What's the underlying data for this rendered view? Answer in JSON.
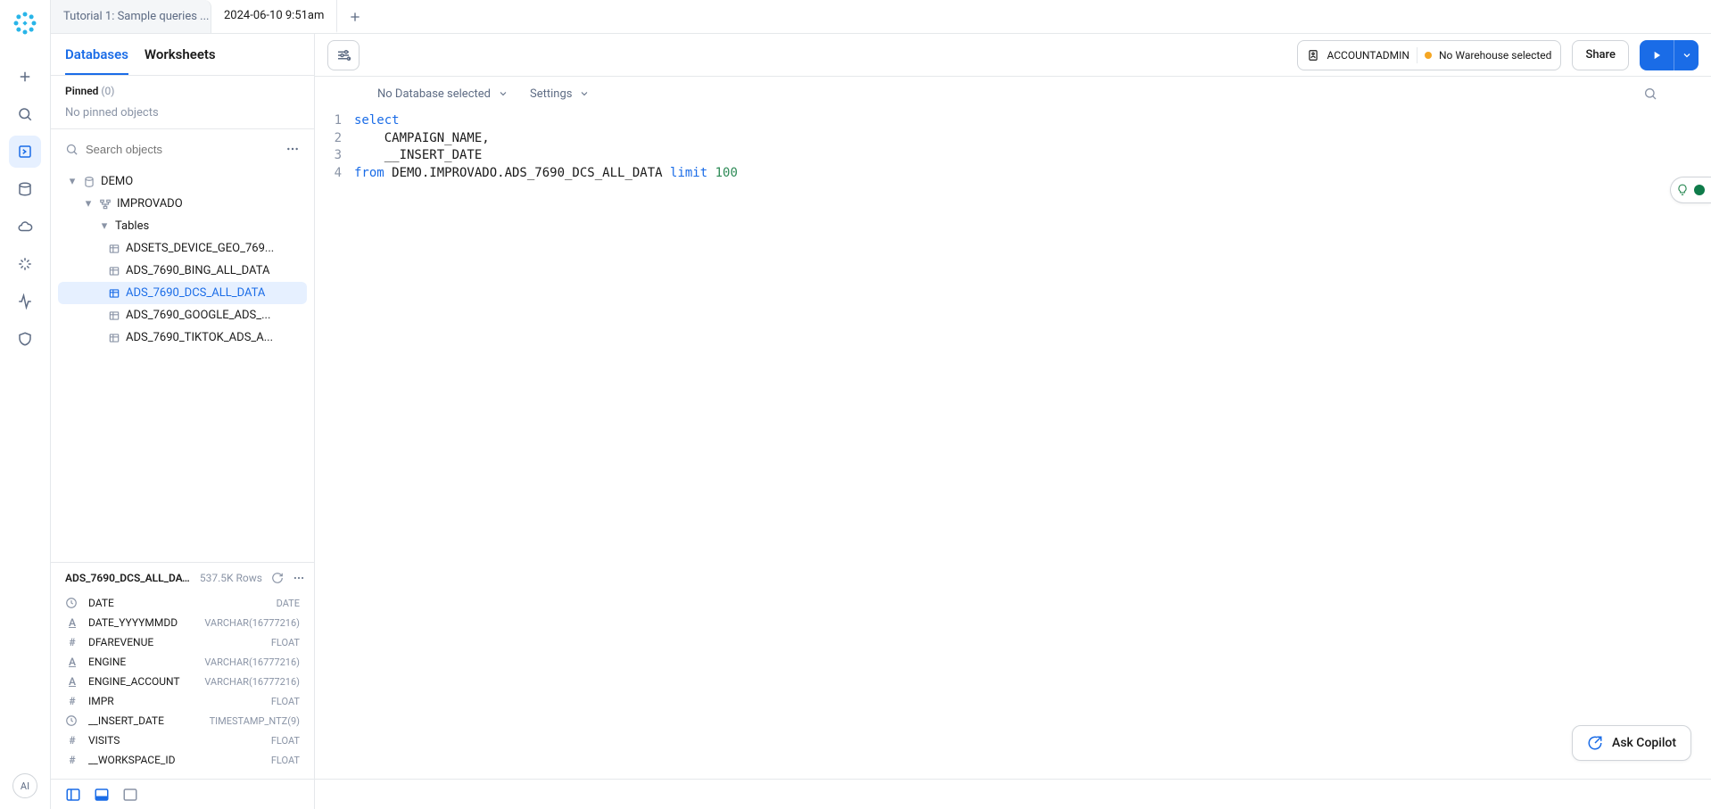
{
  "tabs": [
    {
      "label": "Tutorial 1: Sample queries ...",
      "active": false
    },
    {
      "label": "2024-06-10 9:51am",
      "active": true
    }
  ],
  "browser_tabs": {
    "databases": "Databases",
    "worksheets": "Worksheets"
  },
  "pinned": {
    "label": "Pinned",
    "count": "(0)",
    "empty": "No pinned objects"
  },
  "search": {
    "placeholder": "Search objects"
  },
  "tree": {
    "db": "DEMO",
    "schema": "IMPROVADO",
    "tables_label": "Tables",
    "tables": [
      "ADSETS_DEVICE_GEO_769...",
      "ADS_7690_BING_ALL_DATA",
      "ADS_7690_DCS_ALL_DATA",
      "ADS_7690_GOOGLE_ADS_...",
      "ADS_7690_TIKTOK_ADS_A..."
    ],
    "selected_index": 2
  },
  "detail": {
    "name": "ADS_7690_DCS_ALL_DATA",
    "rows": "537.5K Rows",
    "columns": [
      {
        "icon": "clock",
        "name": "DATE",
        "type": "DATE"
      },
      {
        "icon": "A",
        "name": "DATE_YYYYMMDD",
        "type": "VARCHAR(16777216)"
      },
      {
        "icon": "#",
        "name": "DFAREVENUE",
        "type": "FLOAT"
      },
      {
        "icon": "A",
        "name": "ENGINE",
        "type": "VARCHAR(16777216)"
      },
      {
        "icon": "A",
        "name": "ENGINE_ACCOUNT",
        "type": "VARCHAR(16777216)"
      },
      {
        "icon": "#",
        "name": "IMPR",
        "type": "FLOAT"
      },
      {
        "icon": "clock",
        "name": "__INSERT_DATE",
        "type": "TIMESTAMP_NTZ(9)"
      },
      {
        "icon": "#",
        "name": "VISITS",
        "type": "FLOAT"
      },
      {
        "icon": "#",
        "name": "__WORKSPACE_ID",
        "type": "FLOAT"
      }
    ]
  },
  "toolbar": {
    "role": "ACCOUNTADMIN",
    "warehouse": "No Warehouse selected",
    "share": "Share"
  },
  "context": {
    "database": "No Database selected",
    "settings": "Settings"
  },
  "code": {
    "lines": [
      "1",
      "2",
      "3",
      "4"
    ],
    "l1_kw": "select",
    "l2": "    CAMPAIGN_NAME,",
    "l3": "    __INSERT_DATE",
    "l4_kw1": "from",
    "l4_mid": " DEMO.IMPROVADO.ADS_7690_DCS_ALL_DATA ",
    "l4_kw2": "limit",
    "l4_sp": " ",
    "l4_num": "100"
  },
  "copilot": "Ask Copilot",
  "rail_ai": "AI"
}
